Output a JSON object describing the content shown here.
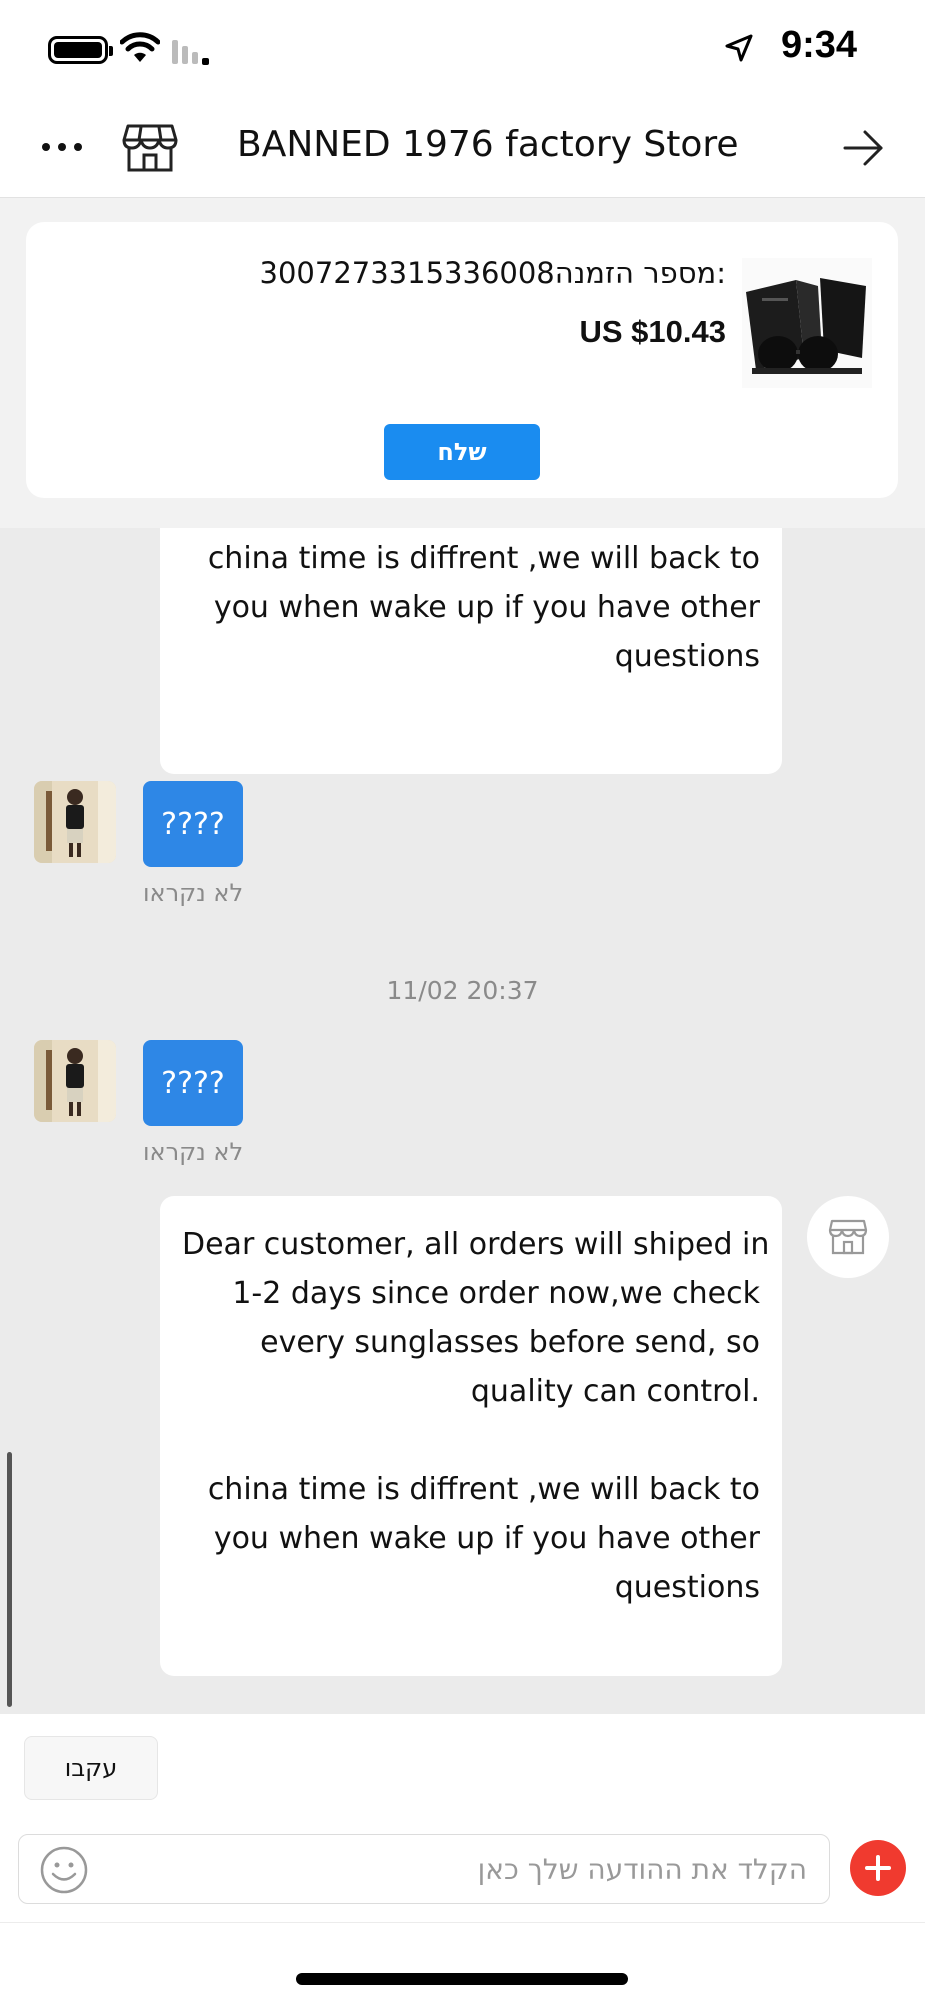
{
  "status_bar": {
    "time": "9:34"
  },
  "header": {
    "title": "BANNED 1976 factory Store",
    "more_icon": "more-horizontal-icon",
    "store_icon": "storefront-icon",
    "forward_icon": "arrow-right-icon"
  },
  "order_card": {
    "order_number": "3007273315336008מספר הזמנה:",
    "price": "US $10.43",
    "send_label": "שלח"
  },
  "chat": {
    "messages": [
      {
        "sender": "store",
        "lines": [
          "china time is diffrent ,we  will back to",
          "you when wake up if you have other",
          "questions"
        ]
      },
      {
        "sender": "user",
        "text": "????",
        "status": "לא נקראו"
      },
      {
        "timestamp": "11/02 20:37"
      },
      {
        "sender": "user",
        "text": "????",
        "status": "לא נקראו"
      },
      {
        "sender": "store",
        "lines": [
          "Dear customer, all orders  will shiped in",
          "1-2 days since order now,we check",
          "every sunglasses before send, so",
          "quality can control.",
          "",
          "china time is diffrent ,we  will back to",
          "you when wake up if you have other",
          "questions"
        ]
      }
    ]
  },
  "footer": {
    "follow_label": "עקבו",
    "input_placeholder": "הקלד את ההודעה שלך כאן",
    "emoji_icon": "smiley-icon",
    "plus_icon": "plus-icon"
  },
  "colors": {
    "accent_blue": "#1a8cf0",
    "user_bubble": "#2e87e6",
    "plus_red": "#f03a2f",
    "chat_background": "#ebebeb"
  }
}
